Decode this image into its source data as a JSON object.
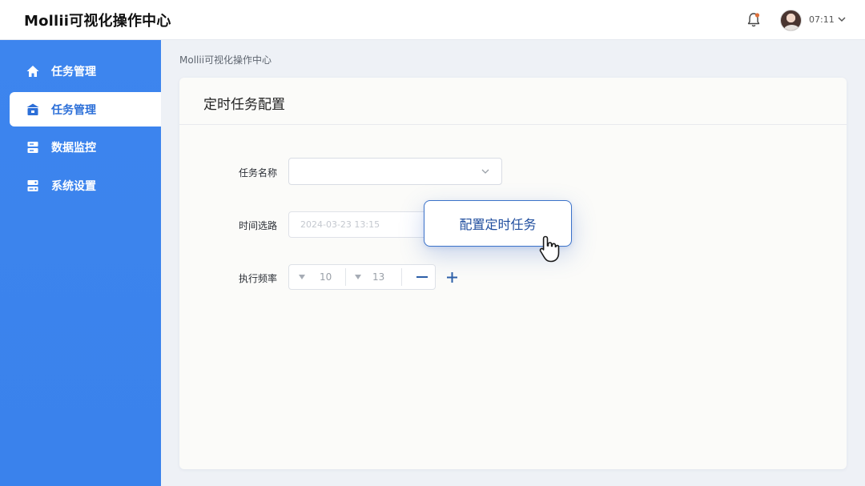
{
  "header": {
    "app_title": "Mollii可视化操作中心",
    "user_time": "07:11",
    "icons": {
      "notification": "bell-icon",
      "user_menu": "chevron-down-icon"
    }
  },
  "sidebar": {
    "items": [
      {
        "label": "任务管理",
        "icon": "home-icon",
        "active": false
      },
      {
        "label": "任务管理",
        "icon": "task-box-icon",
        "active": true
      },
      {
        "label": "数据监控",
        "icon": "database-icon",
        "active": false
      },
      {
        "label": "系统设置",
        "icon": "settings-server-icon",
        "active": false
      }
    ]
  },
  "breadcrumb": "Mollii可视化操作中心",
  "card": {
    "title": "定时任务配置"
  },
  "form": {
    "task_name": {
      "label": "任务名称",
      "value": ""
    },
    "time_select": {
      "label": "时间选路",
      "placeholder": "2024-03-23  13:15"
    },
    "frequency": {
      "label": "执行频率",
      "value_a": "10",
      "value_b": "13"
    }
  },
  "popover": {
    "label": "配置定时任务"
  },
  "colors": {
    "sidebar": "#3d85ee",
    "active_text": "#2c6fd8",
    "popover_border": "#3b72c9",
    "popover_text": "#1f4d9e",
    "bell": "#e0703a"
  }
}
